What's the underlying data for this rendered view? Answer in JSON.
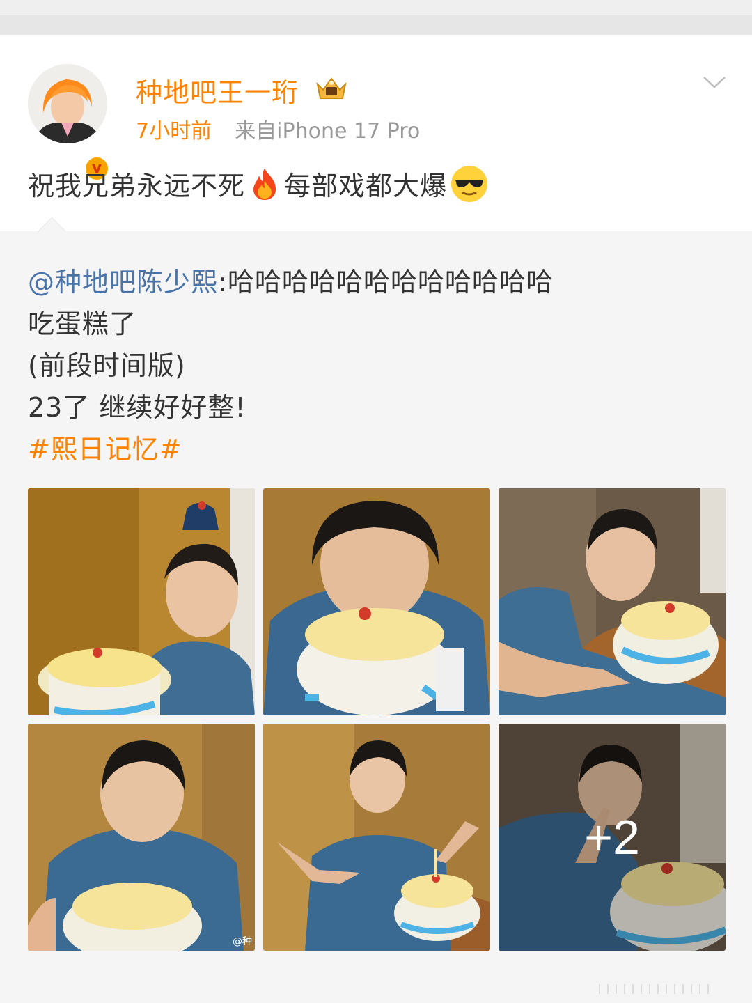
{
  "post": {
    "username": "种地吧王一珩",
    "time": "7小时前",
    "source": "来自iPhone 17 Pro",
    "text_part1": "祝我兄弟永远不死",
    "text_part2": "每部戏都大爆",
    "emoji_1": "fire",
    "emoji_2": "cool-sunglasses",
    "verified_badge": "v",
    "colors": {
      "username": "#ff8200",
      "link": "#4a74a8",
      "hashtag": "#ff8200"
    }
  },
  "repost": {
    "mention": "@种地吧陈少熙",
    "line1_rest": ":哈哈哈哈哈哈哈哈哈哈哈哈",
    "line2": "吃蛋糕了",
    "line3": "(前段时间版)",
    "line4": "23了 继续好好整!",
    "hashtag": "#熙日记忆#",
    "photos": [
      {
        "label": "photo-1"
      },
      {
        "label": "photo-2"
      },
      {
        "label": "photo-3"
      },
      {
        "label": "photo-4",
        "watermark": "@种"
      },
      {
        "label": "photo-5"
      },
      {
        "label": "photo-6",
        "overlay": "+2"
      }
    ]
  }
}
